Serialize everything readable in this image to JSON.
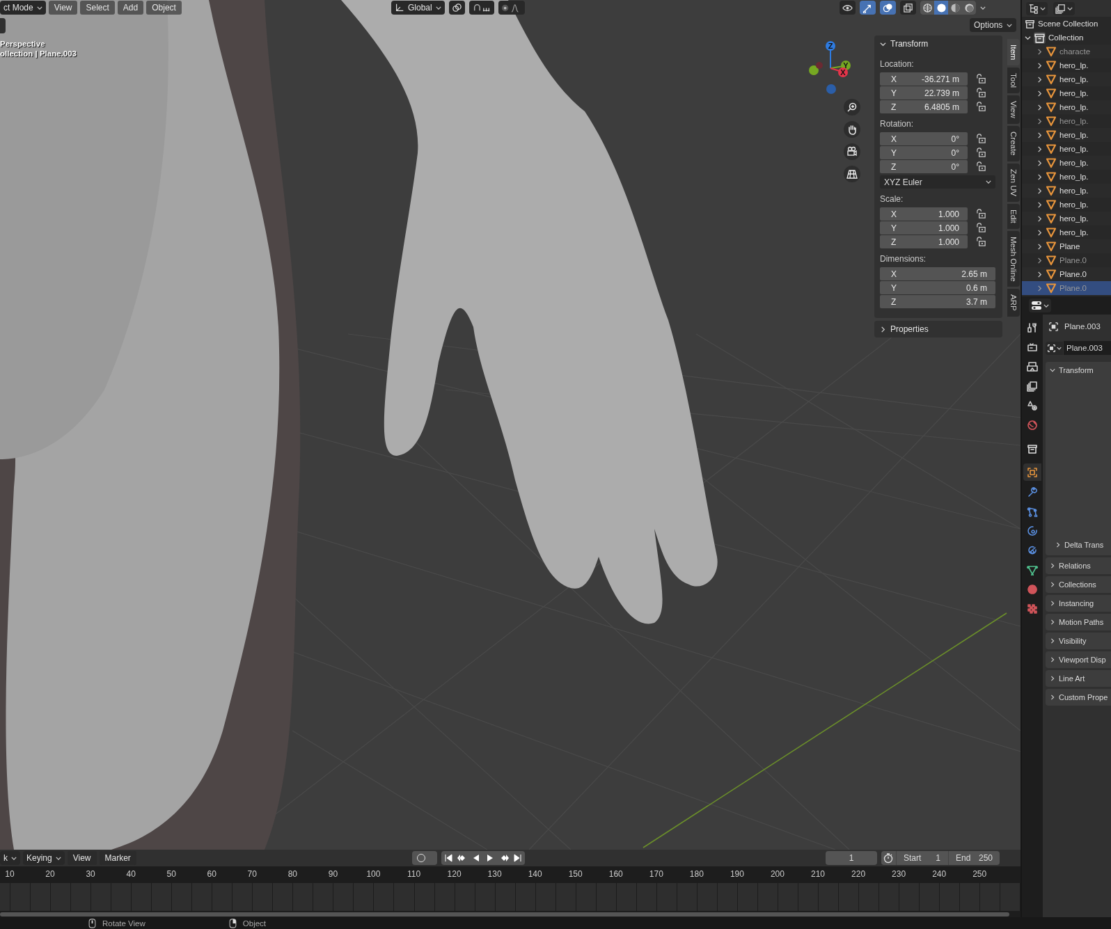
{
  "viewport": {
    "header": {
      "mode": "ct Mode",
      "menus": [
        "View",
        "Select",
        "Add",
        "Object"
      ],
      "orientation": "Global",
      "toggles": [
        {
          "kind": "visibility",
          "on": false
        },
        {
          "kind": "gizmo",
          "on": true
        },
        {
          "kind": "overlay",
          "on": true
        },
        {
          "kind": "xray",
          "on": false
        }
      ],
      "shading": [
        {
          "kind": "wireframe",
          "selected": false
        },
        {
          "kind": "solid",
          "selected": true
        },
        {
          "kind": "material",
          "selected": false
        },
        {
          "kind": "rendered",
          "selected": false
        }
      ]
    },
    "options": "Options",
    "view_name": "Perspective",
    "view_info": "ollection | Plane.003",
    "gizmo_axes": [
      {
        "label": "Z",
        "color": "#2e7be0"
      },
      {
        "label": "Y",
        "color": "#76a822"
      },
      {
        "label": "X",
        "color": "#e4344a"
      }
    ],
    "sidebar": {
      "tabs": [
        {
          "label": "Item",
          "selected": true
        },
        {
          "label": "Tool",
          "selected": false
        },
        {
          "label": "View",
          "selected": false
        },
        {
          "label": "Create",
          "selected": false
        },
        {
          "label": "Zen UV",
          "selected": false
        },
        {
          "label": "Edit",
          "selected": false
        },
        {
          "label": "Mesh Online",
          "selected": false
        },
        {
          "label": "ARP",
          "selected": false
        }
      ],
      "transform": {
        "title": "Transform",
        "expanded": true,
        "groups": [
          {
            "label": "Location:",
            "lockable": true,
            "fields": [
              {
                "axis": "X",
                "value": "-36.271 m"
              },
              {
                "axis": "Y",
                "value": "22.739 m"
              },
              {
                "axis": "Z",
                "value": "6.4805 m"
              }
            ]
          },
          {
            "label": "Rotation:",
            "lockable": true,
            "fields": [
              {
                "axis": "X",
                "value": "0°"
              },
              {
                "axis": "Y",
                "value": "0°"
              },
              {
                "axis": "Z",
                "value": "0°"
              }
            ],
            "mode": "XYZ Euler"
          },
          {
            "label": "Scale:",
            "lockable": true,
            "fields": [
              {
                "axis": "X",
                "value": "1.000"
              },
              {
                "axis": "Y",
                "value": "1.000"
              },
              {
                "axis": "Z",
                "value": "1.000"
              }
            ]
          },
          {
            "label": "Dimensions:",
            "lockable": false,
            "fields": [
              {
                "axis": "X",
                "value": "2.65 m"
              },
              {
                "axis": "Y",
                "value": "0.6 m"
              },
              {
                "axis": "Z",
                "value": "3.7 m"
              }
            ]
          }
        ]
      },
      "properties": {
        "title": "Properties",
        "expanded": false
      }
    }
  },
  "outliner": {
    "root": "Scene Collection",
    "collection": {
      "name": "Collection",
      "expanded": true,
      "children": [
        {
          "name": "characte",
          "dimmed": true,
          "selected": false
        },
        {
          "name": "hero_lp.",
          "dimmed": false,
          "selected": false
        },
        {
          "name": "hero_lp.",
          "dimmed": false,
          "selected": false
        },
        {
          "name": "hero_lp.",
          "dimmed": false,
          "selected": false
        },
        {
          "name": "hero_lp.",
          "dimmed": false,
          "selected": false
        },
        {
          "name": "hero_lp.",
          "dimmed": true,
          "selected": false
        },
        {
          "name": "hero_lp.",
          "dimmed": false,
          "selected": false
        },
        {
          "name": "hero_lp.",
          "dimmed": false,
          "selected": false
        },
        {
          "name": "hero_lp.",
          "dimmed": false,
          "selected": false
        },
        {
          "name": "hero_lp.",
          "dimmed": false,
          "selected": false
        },
        {
          "name": "hero_lp.",
          "dimmed": false,
          "selected": false
        },
        {
          "name": "hero_lp.",
          "dimmed": false,
          "selected": false
        },
        {
          "name": "hero_lp.",
          "dimmed": false,
          "selected": false
        },
        {
          "name": "hero_lp.",
          "dimmed": false,
          "selected": false
        },
        {
          "name": "Plane",
          "dimmed": false,
          "selected": false
        },
        {
          "name": "Plane.0",
          "dimmed": true,
          "selected": false
        },
        {
          "name": "Plane.0",
          "dimmed": false,
          "selected": false
        },
        {
          "name": "Plane.0",
          "dimmed": true,
          "selected": true
        }
      ]
    }
  },
  "properties": {
    "tabs": [
      {
        "kind": "tool",
        "selected": false
      },
      {
        "kind": "render",
        "selected": false
      },
      {
        "kind": "output",
        "selected": false
      },
      {
        "kind": "view_layer",
        "selected": false
      },
      {
        "kind": "scene",
        "selected": false
      },
      {
        "kind": "world",
        "selected": false
      },
      {
        "kind": "collection",
        "selected": false
      },
      {
        "kind": "object",
        "selected": true
      },
      {
        "kind": "modifiers",
        "selected": false
      },
      {
        "kind": "particles",
        "selected": false
      },
      {
        "kind": "physics",
        "selected": false
      },
      {
        "kind": "constraints",
        "selected": false
      },
      {
        "kind": "data",
        "selected": false
      },
      {
        "kind": "material",
        "selected": false
      },
      {
        "kind": "texture",
        "selected": false
      }
    ],
    "object_name": "Plane.003",
    "datablock": "Plane.003",
    "panels": [
      {
        "title": "Transform",
        "expanded": true,
        "children": [
          {
            "title": "Delta Trans",
            "expanded": false
          }
        ]
      },
      {
        "title": "Relations",
        "expanded": false
      },
      {
        "title": "Collections",
        "expanded": false
      },
      {
        "title": "Instancing",
        "expanded": false
      },
      {
        "title": "Motion Paths",
        "expanded": false
      },
      {
        "title": "Visibility",
        "expanded": false
      },
      {
        "title": "Viewport Disp",
        "expanded": false
      },
      {
        "title": "Line Art",
        "expanded": false
      },
      {
        "title": "Custom Prope",
        "expanded": false
      }
    ]
  },
  "timeline": {
    "menus": [
      {
        "label": "k",
        "dropdown": true
      },
      {
        "label": "Keying",
        "dropdown": true
      },
      {
        "label": "View",
        "dropdown": false
      },
      {
        "label": "Marker",
        "dropdown": false
      }
    ],
    "auto_keying": false,
    "current_frame": "1",
    "start_label": "Start",
    "start": "1",
    "end_label": "End",
    "end": "250",
    "ruler": [
      "10",
      "20",
      "30",
      "40",
      "50",
      "60",
      "70",
      "80",
      "90",
      "100",
      "110",
      "120",
      "130",
      "140",
      "150",
      "160",
      "170",
      "180",
      "190",
      "200",
      "210",
      "220",
      "230",
      "240",
      "250"
    ]
  },
  "status_bar": [
    {
      "kind": "middle",
      "label": "Rotate View"
    },
    {
      "kind": "right",
      "label": "Object"
    }
  ]
}
